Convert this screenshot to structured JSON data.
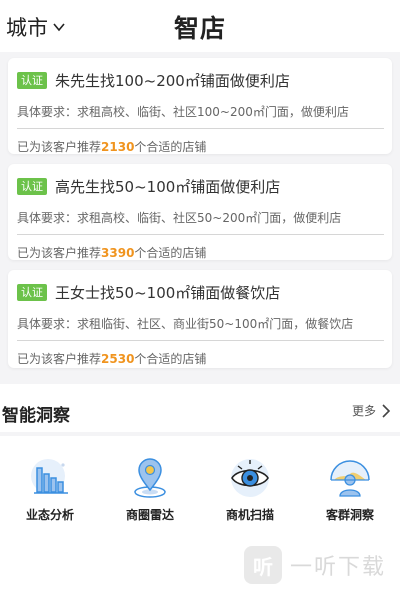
{
  "header": {
    "city_label": "城市",
    "title": "智店"
  },
  "demands": [
    {
      "badge": "认证",
      "title": "朱先生找100~200㎡铺面做便利店",
      "requirement": "具体要求：求租高校、临街、社区100~200㎡门面，做便利店",
      "rec_prefix": "已为该客户推荐",
      "rec_count": "2130",
      "rec_suffix": "个合适的店铺"
    },
    {
      "badge": "认证",
      "title": "高先生找50~100㎡铺面做便利店",
      "requirement": "具体要求：求租高校、临街、社区50~200㎡门面，做便利店",
      "rec_prefix": "已为该客户推荐",
      "rec_count": "3390",
      "rec_suffix": "个合适的店铺"
    },
    {
      "badge": "认证",
      "title": "王女士找50~100㎡铺面做餐饮店",
      "requirement": "具体要求：求租临街、社区、商业街50~100㎡门面，做餐饮店",
      "rec_prefix": "已为该客户推荐",
      "rec_count": "2530",
      "rec_suffix": "个合适的店铺"
    }
  ],
  "insight": {
    "title": "智能洞察",
    "more_label": "更多",
    "tools": [
      {
        "label": "业态分析",
        "icon": "bar-chart-icon"
      },
      {
        "label": "商圈雷达",
        "icon": "location-pin-icon"
      },
      {
        "label": "商机扫描",
        "icon": "eye-scan-icon"
      },
      {
        "label": "客群洞察",
        "icon": "people-icon"
      }
    ]
  },
  "watermark": {
    "glyph": "听",
    "text": "一听下载"
  },
  "colors": {
    "badge": "#6cc24a",
    "highlight": "#f0941f",
    "icon_blue": "#3b8fe0"
  }
}
